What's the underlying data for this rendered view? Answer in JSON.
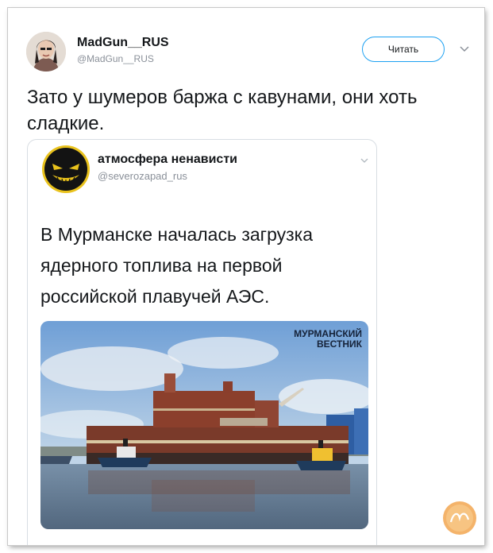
{
  "tweet": {
    "author_name": "MadGun__RUS",
    "author_handle": "@MadGun__RUS",
    "follow_label": "Читать",
    "text": "Зато у шумеров баржа с кавунами, они хоть сладкие."
  },
  "quoted": {
    "author_name": "атмосфера ненависти",
    "author_handle": "@severozapad_rus",
    "text": "В Мурманске началась загрузка ядерного топлива на первой российской плавучей АЭС.",
    "image_caption": "МУРМАНСКИЙ ВЕСТНИК"
  },
  "icons": {
    "menu": "chevron-down-icon",
    "watermark": "site-logo-icon"
  },
  "colors": {
    "accent": "#1da1f2",
    "text": "#14171a",
    "secondary_text": "#8a9099",
    "border": "#d8dee3",
    "ship_hull": "#7a3a2a",
    "water": "#5d7590"
  }
}
